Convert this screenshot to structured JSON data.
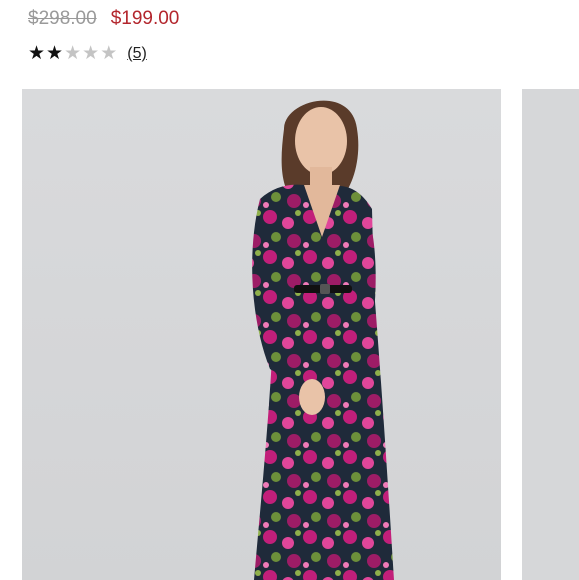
{
  "product": {
    "original_price": "$298.00",
    "sale_price": "$199.00",
    "rating": {
      "filled": 2,
      "total": 5
    },
    "review_count": "(5)"
  },
  "gallery": {
    "main_image_icon": "model-photo-icon",
    "next_image_icon": "next-photo-icon"
  },
  "colors": {
    "sale_price": "#b3262d",
    "original_price": "#9a9a9a",
    "image_background": "#d6d7d9",
    "dress_magenta": "#c21f7a",
    "dress_navy": "#1f2a3a"
  }
}
